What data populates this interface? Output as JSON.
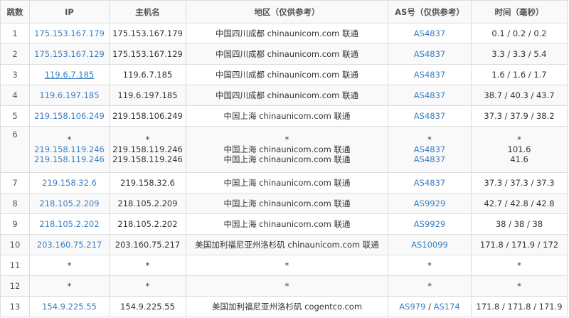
{
  "headers": {
    "hop": "跳数",
    "ip": "IP",
    "host": "主机名",
    "region": "地区（仅供参考）",
    "asn": "AS号（仅供参考）",
    "time": "时间（毫秒）"
  },
  "rows": [
    {
      "hop": "1",
      "ip": "175.153.167.179",
      "host": "175.153.167.179",
      "region": "中国四川成都 chinaunicom.com 联通",
      "asn": "AS4837",
      "time": "0.1 / 0.2 / 0.2"
    },
    {
      "hop": "2",
      "ip": "175.153.167.129",
      "host": "175.153.167.129",
      "region": "中国四川成都 chinaunicom.com 联通",
      "asn": "AS4837",
      "time": "3.3 / 3.3 / 5.4"
    },
    {
      "hop": "3",
      "ip": "119.6.7.185",
      "host": "119.6.7.185",
      "region": "中国四川成都 chinaunicom.com 联通",
      "asn": "AS4837",
      "time": "1.6 / 1.6 / 1.7"
    },
    {
      "hop": "4",
      "ip": "119.6.197.185",
      "host": "119.6.197.185",
      "region": "中国四川成都 chinaunicom.com 联通",
      "asn": "AS4837",
      "time": "38.7 / 40.3 / 43.7"
    },
    {
      "hop": "5",
      "ip": "219.158.106.249",
      "host": "219.158.106.249",
      "region": "中国上海 chinaunicom.com 联通",
      "asn": "AS4837",
      "time": "37.3 / 37.9 / 38.2"
    },
    {
      "hop": "6",
      "ip_lines": [
        "*",
        "219.158.119.246",
        "219.158.119.246"
      ],
      "host_lines": [
        "*",
        "219.158.119.246",
        "219.158.119.246"
      ],
      "region_lines": [
        "*",
        "中国上海 chinaunicom.com 联通",
        "中国上海 chinaunicom.com 联通"
      ],
      "asn_lines": [
        "*",
        "AS4837",
        "AS4837"
      ],
      "time_lines": [
        "*",
        "101.6",
        "41.6"
      ]
    },
    {
      "hop": "7",
      "ip": "219.158.32.6",
      "host": "219.158.32.6",
      "region": "中国上海 chinaunicom.com 联通",
      "asn": "AS4837",
      "time": "37.3 / 37.3 / 37.3"
    },
    {
      "hop": "8",
      "ip": "218.105.2.209",
      "host": "218.105.2.209",
      "region": "中国上海 chinaunicom.com 联通",
      "asn": "AS9929",
      "time": "42.7 / 42.8 / 42.8"
    },
    {
      "hop": "9",
      "ip": "218.105.2.202",
      "host": "218.105.2.202",
      "region": "中国上海 chinaunicom.com 联通",
      "asn": "AS9929",
      "time": "38 / 38 / 38"
    },
    {
      "hop": "10",
      "ip": "203.160.75.217",
      "host": "203.160.75.217",
      "region": "美国加利福尼亚州洛杉矶 chinaunicom.com 联通",
      "asn": "AS10099",
      "time": "171.8 / 171.9 / 172"
    },
    {
      "hop": "11",
      "ip": "*",
      "host": "*",
      "region": "*",
      "asn": "*",
      "time": "*"
    },
    {
      "hop": "12",
      "ip": "*",
      "host": "*",
      "region": "*",
      "asn": "*",
      "time": "*"
    },
    {
      "hop": "13",
      "ip": "154.9.225.55",
      "host": "154.9.225.55",
      "region": "美国加利福尼亚州洛杉矶 cogentco.com",
      "asn": "AS979",
      "asn2": "AS174",
      "asn_sep": "/",
      "time": "171.8 / 171.8 / 171.9"
    }
  ]
}
